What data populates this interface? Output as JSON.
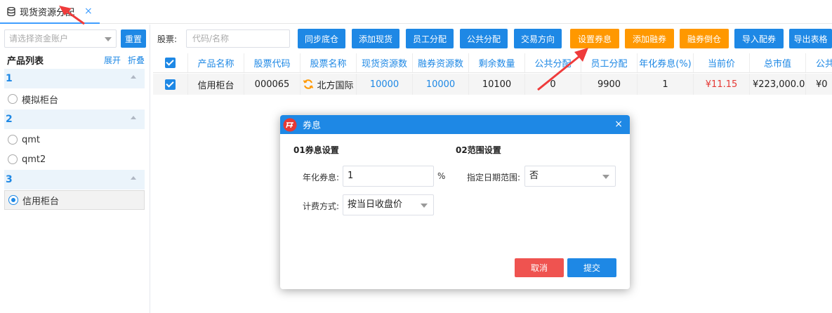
{
  "tab": {
    "title": "现货资源分配",
    "close": "×",
    "icon": "database-icon"
  },
  "sidebar": {
    "account_placeholder": "请选择资金账户",
    "reset_label": "重置",
    "product_list_title": "产品列表",
    "expand_label": "展开",
    "collapse_label": "折叠",
    "groups": [
      {
        "label": "1",
        "items": [
          {
            "label": "模拟柜台",
            "selected": false
          }
        ]
      },
      {
        "label": "2",
        "items": [
          {
            "label": "qmt",
            "selected": false
          },
          {
            "label": "qmt2",
            "selected": false
          }
        ]
      },
      {
        "label": "3",
        "items": [
          {
            "label": "信用柜台",
            "selected": true
          }
        ]
      }
    ]
  },
  "toolbar": {
    "stock_label": "股票:",
    "stock_placeholder": "代码/名称",
    "buttons": [
      {
        "label": "同步底仓",
        "color": "#1e88e5"
      },
      {
        "label": "添加现货",
        "color": "#1e88e5"
      },
      {
        "label": "员工分配",
        "color": "#1e88e5"
      },
      {
        "label": "公共分配",
        "color": "#1e88e5"
      },
      {
        "label": "交易方向",
        "color": "#1e88e5"
      },
      {
        "label": "设置券息",
        "color": "#ff9800"
      },
      {
        "label": "添加融券",
        "color": "#ff9800"
      },
      {
        "label": "融券倒仓",
        "color": "#ff9800"
      },
      {
        "label": "导入配券",
        "color": "#1e88e5"
      },
      {
        "label": "导出表格",
        "color": "#1e88e5"
      }
    ]
  },
  "table": {
    "columns": [
      "产品名称",
      "股票代码",
      "股票名称",
      "现货资源数",
      "融券资源数",
      "剩余数量",
      "公共分配",
      "员工分配",
      "年化券息(%)",
      "当前价",
      "总市值",
      "公共"
    ],
    "rows": [
      [
        "信用柜台",
        "000065",
        "北方国际",
        "10000",
        "10000",
        "10100",
        "0",
        "9900",
        "1",
        "¥11.15",
        "¥223,000.0",
        "¥0"
      ]
    ]
  },
  "dialog": {
    "title": "券息",
    "close": "×",
    "section1": "01券息设置",
    "section2": "02范围设置",
    "rate_label": "年化券息:",
    "rate_value": "1",
    "rate_unit": "%",
    "fee_label": "计费方式:",
    "fee_value": "按当日收盘价",
    "range_label": "指定日期范围:",
    "range_value": "否",
    "cancel_label": "取消",
    "submit_label": "提交"
  },
  "colors": {
    "primary": "#1e88e5",
    "warning": "#ff9800",
    "danger": "#ef5350",
    "price": "#e53935"
  }
}
